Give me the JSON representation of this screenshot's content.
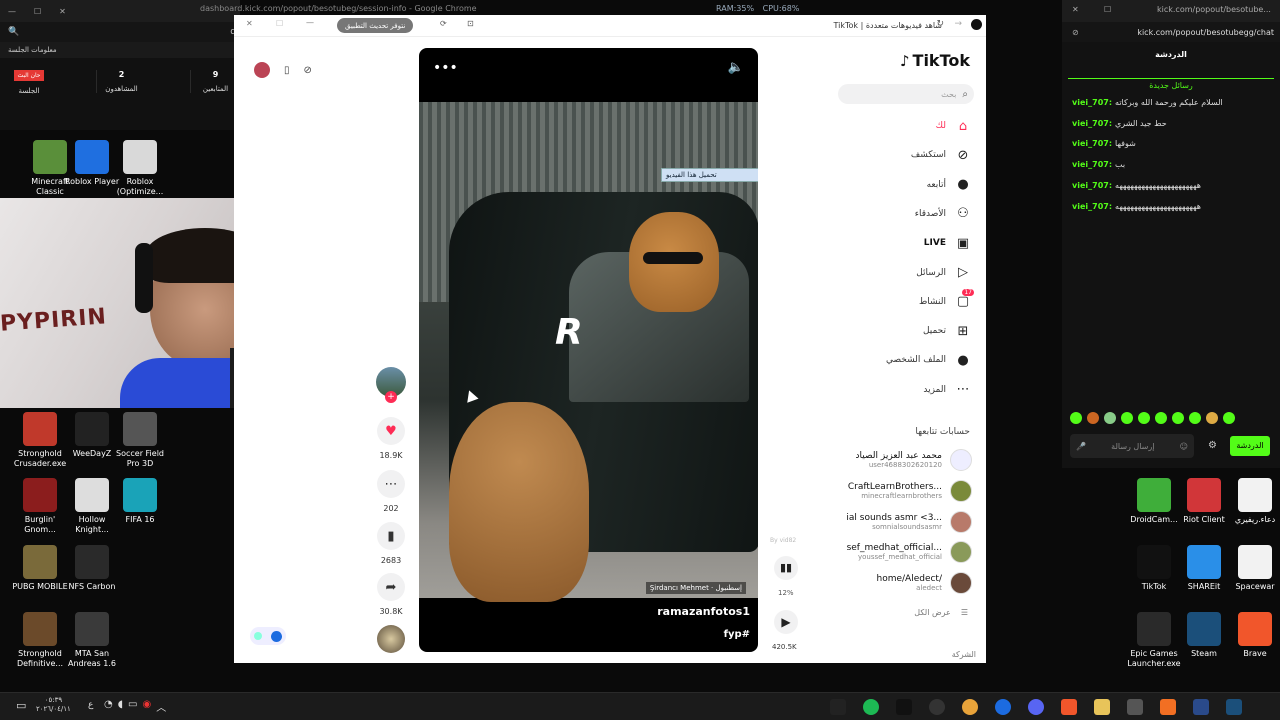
{
  "desktop": {
    "icons_left": [
      {
        "label": "Minecraft Classic",
        "icon": "minecraft-icon",
        "color": "#5a8f3a"
      },
      {
        "label": "Roblox Player",
        "icon": "roblox-icon",
        "color": "#1f6fe0"
      },
      {
        "label": "Roblox (Optimize...",
        "icon": "roblox-optimize-icon",
        "color": "#d9d9d9"
      },
      {
        "label": "Stronghold Crusader.exe",
        "icon": "stronghold-crusader-icon",
        "color": "#c0392b"
      },
      {
        "label": "WeeDayZ",
        "icon": "weedayz-icon",
        "color": "#222"
      },
      {
        "label": "Soccer Field Pro 3D",
        "icon": "soccer-field-icon",
        "color": "#555"
      },
      {
        "label": "Burglin' Gnom...",
        "icon": "burglin-gnomes-icon",
        "color": "#8b1d1d"
      },
      {
        "label": "Hollow Knight...",
        "icon": "hollow-knight-icon",
        "color": "#ddd"
      },
      {
        "label": "FIFA 16",
        "icon": "fifa-icon",
        "color": "#1aa3b8"
      },
      {
        "label": "PUBG MOBILE",
        "icon": "pubg-icon",
        "color": "#7a6a3a"
      },
      {
        "label": "NFS Carbon",
        "icon": "nfs-carbon-icon",
        "color": "#2a2a2a"
      },
      {
        "label": "Stronghold Definitive...",
        "icon": "stronghold-definitive-icon",
        "color": "#6b4a2a"
      },
      {
        "label": "MTA San Andreas 1.6",
        "icon": "mta-icon",
        "color": "#3a3a3a"
      }
    ],
    "icons_right": [
      {
        "label": "DroidCam...",
        "icon": "droidcam-icon",
        "color": "#3fae3a"
      },
      {
        "label": "Riot Client",
        "icon": "riot-client-icon",
        "color": "#d13639"
      },
      {
        "label": "دعاء.ريفيري",
        "icon": "document-icon",
        "color": "#f2f2f2"
      },
      {
        "label": "TikTok",
        "icon": "tiktok-icon",
        "color": "#111"
      },
      {
        "label": "SHAREit",
        "icon": "shareit-icon",
        "color": "#2a8fe8"
      },
      {
        "label": "Spacewar",
        "icon": "spacewar-icon",
        "color": "#f2f2f2"
      },
      {
        "label": "Epic Games Launcher.exe",
        "icon": "epic-games-icon",
        "color": "#2a2a2a"
      },
      {
        "label": "Steam",
        "icon": "steam-icon",
        "color": "#1b4f7a"
      },
      {
        "label": "Brave",
        "icon": "brave-icon",
        "color": "#f1562b"
      }
    ]
  },
  "left_window": {
    "title": "dashboard.kick.com/popout/besotubeg/session-info - Google Chrome",
    "search_glyph": "🔍",
    "section": "معلومات الجلسة",
    "stats": [
      {
        "value": "",
        "label": "الجلسة",
        "badge": "حان البث"
      },
      {
        "value": "2",
        "label": "المشاهدون"
      },
      {
        "value": "9",
        "label": "المتابعين"
      }
    ],
    "letter": "d"
  },
  "perf": {
    "ram": "RAM:35%",
    "cpu": "CPU:68%"
  },
  "main_window": {
    "tab_title": "TikTok | شاهد فيديوهات متعددة",
    "update_pill": "نتوفر تحديث التطبيق"
  },
  "tiktok": {
    "logo": "TikTok",
    "search_placeholder": "بحث",
    "nav": [
      {
        "label": "لك",
        "icon": "home-icon"
      },
      {
        "label": "استكشف",
        "icon": "compass-icon"
      },
      {
        "label": "أتابعه",
        "icon": "following-icon"
      },
      {
        "label": "الأصدقاء",
        "icon": "friends-icon"
      },
      {
        "label": "LIVE",
        "icon": "live-icon"
      },
      {
        "label": "الرسائل",
        "icon": "messages-icon"
      },
      {
        "label": "النشاط",
        "icon": "activity-icon",
        "badge": "17"
      },
      {
        "label": "تحميل",
        "icon": "upload-icon"
      },
      {
        "label": "الملف الشخصي",
        "icon": "profile-icon"
      },
      {
        "label": "المزيد",
        "icon": "more-icon"
      }
    ],
    "following_title": "حسابات تتابعها",
    "following": [
      {
        "name": "محمد عبد العزيز الصياد",
        "user": "user4688302620120"
      },
      {
        "name": "CraftLearnBrothers...",
        "user": "minecraftlearnbrothers"
      },
      {
        "name": "ial sounds asmr <3...",
        "user": "somnialsoundsasmr"
      },
      {
        "name": "sef_medhat_official...",
        "user": "youssef_medhat_official"
      },
      {
        "name": "home/Aledect/",
        "user": "aledect"
      }
    ],
    "see_all": "عرض الكل",
    "company": "الشركة"
  },
  "video": {
    "overlay_button": "تحميل هذا الفيديو",
    "location": "Şirdancı Mehmet · إسطنبول",
    "author": "ramazanfotos1",
    "hashtag": "fyp#",
    "watermark": "R",
    "by": "By vid82",
    "likes": "18.9K",
    "comments": "202",
    "saves": "2683",
    "shares": "30.8K",
    "percent": "12%",
    "views": "420.5K"
  },
  "chat": {
    "url": "kick.com/popout/besotubegg/chat",
    "tab_title": "kick.com/popout/besotube...",
    "title": "الدردشة",
    "new_messages": "رسائل جديدة",
    "messages": [
      {
        "user": "viei_707:",
        "text": "السلام عليكم ورحمة الله وبركاته"
      },
      {
        "user": "viei_707:",
        "text": "حط جيد الشري"
      },
      {
        "user": "viei_707:",
        "text": "شوفها"
      },
      {
        "user": "viei_707:",
        "text": "بب"
      },
      {
        "user": "viei_707:",
        "text": "ههههههههههههههههههههههه"
      },
      {
        "user": "viei_707:",
        "text": "ههههههههههههههههههههههه"
      }
    ],
    "input_placeholder": "إرسال رسالة",
    "send_button": "الدردشة"
  },
  "taskbar": {
    "time": "٠٥:٣٩",
    "date": "٢٠٢٦/٠٤/١١",
    "lang": "ع",
    "accent": "#53fc18"
  },
  "webcam_text": "PYPIRIN"
}
